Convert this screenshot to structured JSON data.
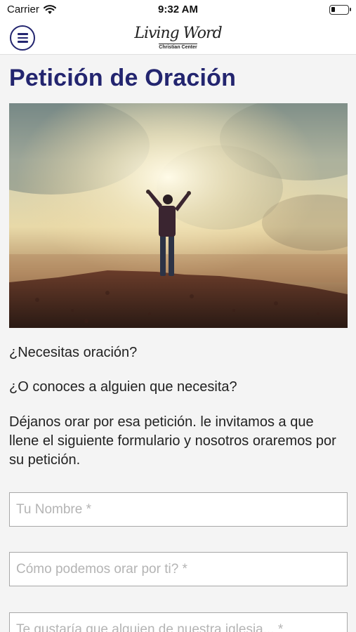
{
  "status_bar": {
    "carrier": "Carrier",
    "time": "9:32 AM",
    "battery_level": 0.25
  },
  "header": {
    "menu_icon": "hamburger-menu-icon",
    "logo_script": "Living Word",
    "logo_sub": "Christian Center"
  },
  "page": {
    "title": "Petición de Oración",
    "paragraphs": [
      "¿Necesitas oración?",
      "¿O conoces a alguien que necesita?",
      "Déjanos orar por esa petición. le invitamos a que llene el siguiente formulario y nosotros oraremos por su petición."
    ]
  },
  "form": {
    "name_placeholder": "Tu Nombre *",
    "prayer_placeholder": "Cómo podemos orar por ti? *",
    "contact_placeholder": "Te gustaría que alguien de nuestra iglesia... *"
  },
  "colors": {
    "brand_navy": "#23256f",
    "background": "#f4f4f4"
  }
}
